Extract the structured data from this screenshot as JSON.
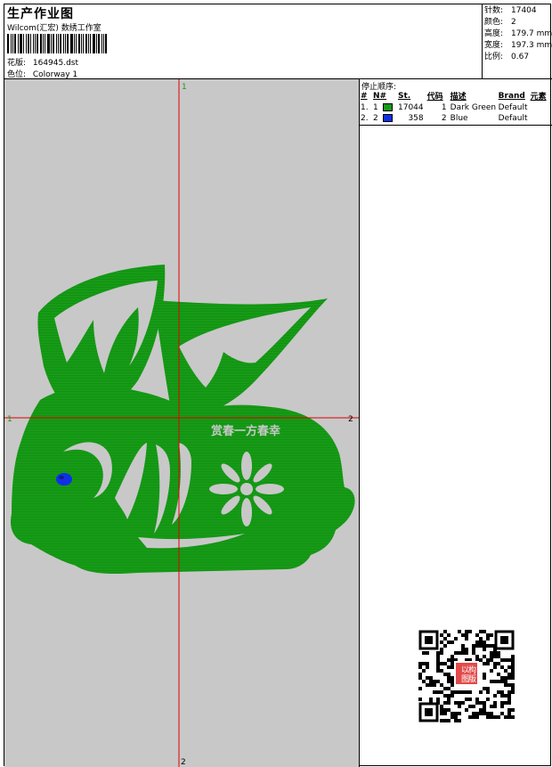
{
  "header": {
    "title": "生产作业图",
    "subtitle": "Wilcom(汇宏) 数绣工作室",
    "design_label": "花版:",
    "design_file": "164945.dst",
    "colorway_label": "色位:",
    "colorway": "Colorway 1"
  },
  "stats": [
    {
      "label": "针数:",
      "value": "17404"
    },
    {
      "label": "颜色:",
      "value": "2"
    },
    {
      "label": "高度:",
      "value": "179.7 mm"
    },
    {
      "label": "宽度:",
      "value": "197.3 mm"
    },
    {
      "label": "比例:",
      "value": "0.67"
    }
  ],
  "stop_sequence": {
    "title": "停止顺序:",
    "columns": [
      "#",
      "N#",
      "St.",
      "代码",
      "描述",
      "Brand",
      "元素"
    ],
    "rows": [
      {
        "index": "1.",
        "n": "1",
        "color": "#169b16",
        "stitches": "17044",
        "code": "1",
        "description": "Dark Green",
        "brand": "Default"
      },
      {
        "index": "2.",
        "n": "2",
        "color": "#1030e8",
        "stitches": "358",
        "code": "2",
        "description": "Blue",
        "brand": "Default"
      }
    ]
  },
  "canvas": {
    "background": "#c8c8c8",
    "design_color": "#169b16",
    "eye_color": "#1030e8",
    "axis_color": "#e00000",
    "axis_labels": {
      "top": "1",
      "bottom": "2",
      "left": "1",
      "right": "2"
    },
    "embroidery_text": "赏春一方春幸"
  },
  "qr": {
    "stamp_text": [
      "以",
      "构",
      "图",
      "版"
    ],
    "stamp_color": "#e24a4a"
  }
}
